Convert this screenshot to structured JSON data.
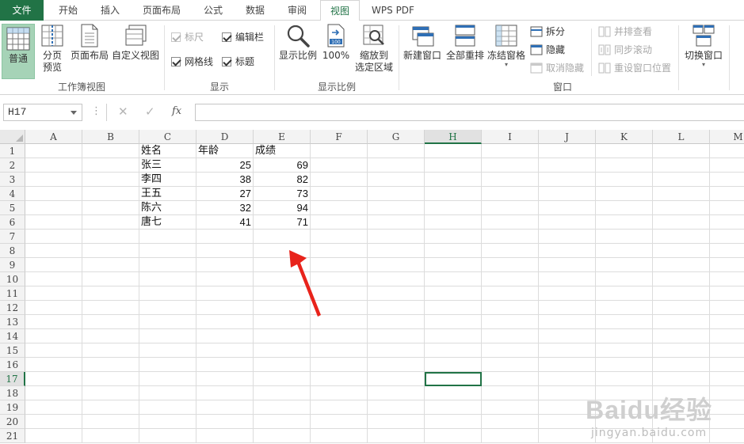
{
  "tabs": [
    "文件",
    "开始",
    "插入",
    "页面布局",
    "公式",
    "数据",
    "审阅",
    "视图",
    "WPS PDF"
  ],
  "active_tab": "视图",
  "ribbon": {
    "workbook_views": {
      "normal": "普通",
      "page_break_1": "分页",
      "page_break_2": "预览",
      "page_layout": "页面布局",
      "custom_views": "自定义视图",
      "group_label": "工作簿视图"
    },
    "show": {
      "ruler": "标尺",
      "formula_bar": "编辑栏",
      "gridlines": "网格线",
      "headings": "标题",
      "group_label": "显示"
    },
    "zoom": {
      "zoom": "显示比例",
      "zoom_100": "100%",
      "zoom_selection_1": "缩放到",
      "zoom_selection_2": "选定区域",
      "group_label": "显示比例"
    },
    "window": {
      "new_window": "新建窗口",
      "arrange_all": "全部重排",
      "freeze_panes": "冻结窗格",
      "split": "拆分",
      "hide": "隐藏",
      "unhide": "取消隐藏",
      "view_side_by_side": "并排查看",
      "sync_scroll": "同步滚动",
      "reset_position": "重设窗口位置",
      "switch_windows": "切换窗口",
      "group_label": "窗口"
    }
  },
  "formula_bar": {
    "name_box": "H17",
    "fx_label": "fx",
    "content": ""
  },
  "sheet": {
    "columns": [
      "A",
      "B",
      "C",
      "D",
      "E",
      "F",
      "G",
      "H",
      "I",
      "J",
      "K",
      "L",
      "M"
    ],
    "rows": [
      "1",
      "2",
      "3",
      "4",
      "5",
      "6",
      "7",
      "8",
      "9",
      "10",
      "11",
      "12",
      "13",
      "14",
      "15",
      "16",
      "17",
      "18",
      "19",
      "20",
      "21"
    ],
    "selected_column": "H",
    "selected_row": "17",
    "headers": [
      "姓名",
      "年龄",
      "成绩"
    ],
    "data": [
      [
        "张三",
        "25",
        "69"
      ],
      [
        "李四",
        "38",
        "82"
      ],
      [
        "王五",
        "27",
        "73"
      ],
      [
        "陈六",
        "32",
        "94"
      ],
      [
        "唐七",
        "41",
        "71"
      ]
    ]
  },
  "watermark": {
    "main": "Baidu经验",
    "sub": "jingyan.baidu.com"
  },
  "colors": {
    "accent": "#217346",
    "arrow": "#e8231b",
    "selected_button": "#a6d3b7"
  }
}
